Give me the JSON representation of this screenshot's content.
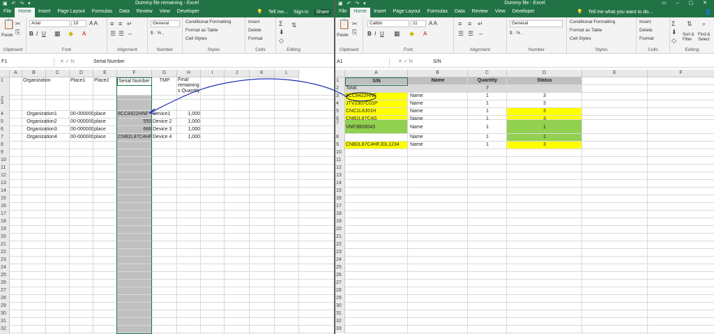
{
  "colors": {
    "accent": "#217346",
    "yellow": "#ffff00",
    "green": "#92d050",
    "gray": "#c0c0c0",
    "annotation": "#1f2fb5"
  },
  "left": {
    "title": "Dummy file remaining - Excel",
    "tabs": [
      "File",
      "Home",
      "Insert",
      "Page Layout",
      "Formulas",
      "Data",
      "Review",
      "View",
      "Developer"
    ],
    "tell_me": "Tell me...",
    "sign_in": "Sign in",
    "share": "Share",
    "font_name": "Arial",
    "font_size": "10",
    "number_format": "General",
    "ribbon": {
      "paste": "Paste",
      "clipboard": "Clipboard",
      "font": "Font",
      "alignment": "Alignment",
      "number": "Number",
      "conditional": "Conditional Formatting",
      "format_table": "Format as Table",
      "cell_styles": "Cell Styles",
      "styles": "Styles",
      "insert": "Insert",
      "delete": "Delete",
      "format": "Format",
      "cells": "Cells",
      "editing": "Editing"
    },
    "name_box": "F1",
    "formula": "Serial Number",
    "columns": [
      "A",
      "B",
      "C",
      "D",
      "E",
      "F",
      "G",
      "H",
      "I",
      "J",
      "K",
      "L"
    ],
    "headers": {
      "org": "Organization",
      "place1": "Place1",
      "place2": "Place2",
      "serial": "Serial Number",
      "tmp": "TMP",
      "final": "Final remaining s Quantity"
    },
    "rows": [
      {
        "org": "Organization1",
        "place1": "00-000000",
        "place2": "place",
        "serial": "8CC8422HNF",
        "tmp": "Device1",
        "qty": "1,000"
      },
      {
        "org": "Organization2",
        "place1": "00-000000",
        "place2": "place",
        "serial": "555",
        "tmp": "Device 2",
        "qty": "1,000"
      },
      {
        "org": "Organization3",
        "place1": "00-000000",
        "place2": "place",
        "serial": "666",
        "tmp": "Device 3",
        "qty": "1,000"
      },
      {
        "org": "Organization4",
        "place1": "00-000000",
        "place2": "place",
        "serial": "CNB2L87C4HF",
        "tmp": "Device 4",
        "qty": "1,000"
      }
    ]
  },
  "right": {
    "title": "Dummy file - Excel",
    "tabs": [
      "File",
      "Home",
      "Insert",
      "Page Layout",
      "Formulas",
      "Data",
      "Review",
      "View",
      "Developer"
    ],
    "tell_me": "Tell me what you want to do...",
    "font_name": "Calibri",
    "font_size": "11",
    "number_format": "General",
    "ribbon": {
      "paste": "Paste",
      "clipboard": "Clipboard",
      "font": "Font",
      "alignment": "Alignment",
      "number": "Number",
      "conditional": "Conditional Formatting",
      "format_table": "Format as Table",
      "cell_styles": "Cell Styles",
      "styles": "Styles",
      "insert": "Insert",
      "delete": "Delete",
      "format": "Format",
      "cells": "Cells",
      "sort_filter": "Sort & Filter",
      "find_select": "Find & Select",
      "editing": "Editing"
    },
    "name_box": "A1",
    "formula": "S/N",
    "columns": [
      "A",
      "B",
      "C",
      "D",
      "E",
      "F"
    ],
    "headers": {
      "sn": "S/N",
      "name": "Name",
      "qty": "Quantity",
      "status": "Status"
    },
    "total_label": "Total:",
    "total_qty": "7",
    "rows": [
      {
        "sn": "8CC8422HNF",
        "name": "Name",
        "qty": "1",
        "status": "3"
      },
      {
        "sn": "JTV2307C01P",
        "name": "Name",
        "qty": "1",
        "status": "3"
      },
      {
        "sn": "CNC1L8J01H",
        "name": "Name",
        "qty": "1",
        "status": "3"
      },
      {
        "sn": "CNB2L87C4G",
        "name": "Name",
        "qty": "1",
        "status": "3"
      },
      {
        "sn": "VNF3B06043",
        "name": "Name",
        "qty": "1",
        "status": "1"
      },
      {
        "sn": "",
        "name": "Name",
        "qty": "1",
        "status": "1"
      },
      {
        "sn": "CNB2L87C4HFJDL1234",
        "name": "Name",
        "qty": "1",
        "status": "3"
      }
    ]
  }
}
